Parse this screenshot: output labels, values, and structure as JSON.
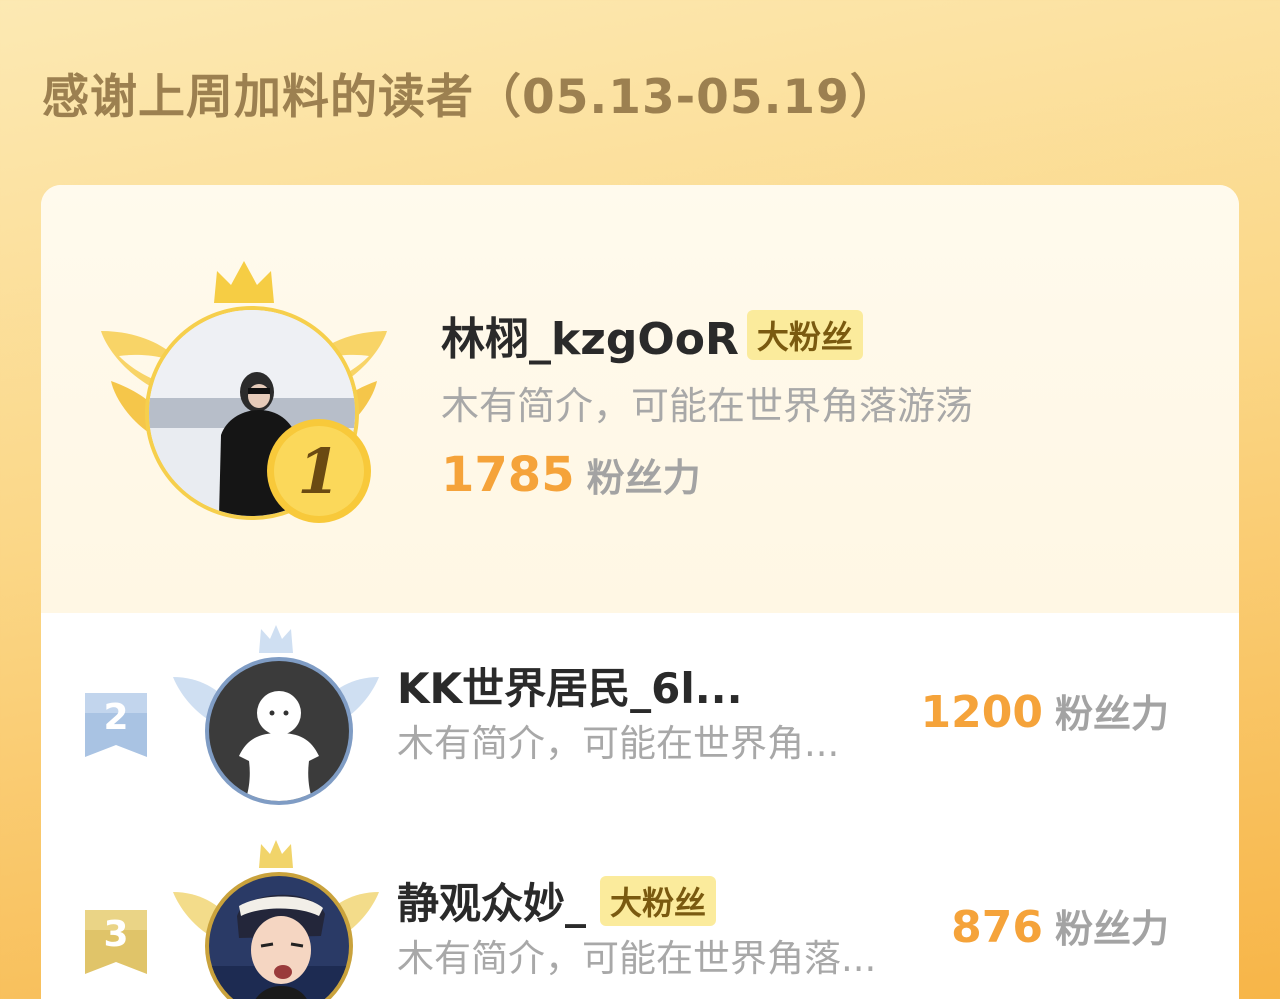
{
  "title": "感谢上周加料的读者（05.13-05.19）",
  "colors": {
    "accent_orange": "#f5a33a",
    "gold": "#f6cf4c",
    "silver": "#a9c3e3",
    "bronze": "#e6cf7a",
    "badge_bg": "#fbeb9c"
  },
  "readers": [
    {
      "rank": "1",
      "name": "林栩_kzgOoR",
      "badge": "大粉丝",
      "intro": "木有简介，可能在世界角落游荡",
      "score": "1785",
      "score_unit": "粉丝力"
    },
    {
      "rank": "2",
      "name": "KK世界居民_6l...",
      "badge": "",
      "intro": "木有简介，可能在世界角...",
      "score": "1200",
      "score_unit": "粉丝力"
    },
    {
      "rank": "3",
      "name": "静观众妙_",
      "badge": "大粉丝",
      "intro": "木有简介，可能在世界角落...",
      "score": "876",
      "score_unit": "粉丝力"
    }
  ]
}
